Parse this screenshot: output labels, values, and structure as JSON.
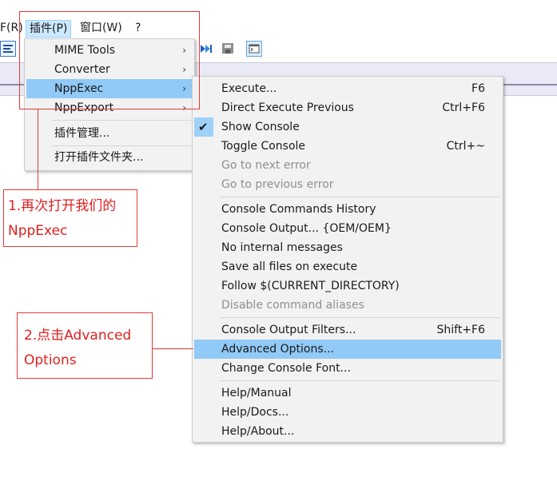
{
  "menubar": {
    "item_r": "F(R)",
    "plugins": "插件(P)",
    "window": "窗口(W)",
    "help": "?"
  },
  "plugins_menu": {
    "items": [
      {
        "label": "MIME Tools",
        "arrow": "›"
      },
      {
        "label": "Converter",
        "arrow": "›"
      },
      {
        "label": "NppExec",
        "arrow": "›"
      },
      {
        "label": "NppExport",
        "arrow": "›"
      },
      {
        "label": "插件管理..."
      },
      {
        "label": "打开插件文件夹..."
      }
    ]
  },
  "nppexec_menu": {
    "items": [
      {
        "label": "Execute...",
        "accel": "F6"
      },
      {
        "label": "Direct Execute Previous",
        "accel": "Ctrl+F6"
      },
      {
        "label": "Show Console",
        "accel": "",
        "checked": true
      },
      {
        "label": "Toggle Console",
        "accel": "Ctrl+~"
      },
      {
        "label": "Go to next error",
        "accel": ""
      },
      {
        "label": "Go to previous error",
        "accel": ""
      },
      {
        "label": "Console Commands History",
        "accel": ""
      },
      {
        "label": "Console Output... {OEM/OEM}",
        "accel": ""
      },
      {
        "label": "No internal messages",
        "accel": ""
      },
      {
        "label": "Save all files on execute",
        "accel": ""
      },
      {
        "label": "Follow $(CURRENT_DIRECTORY)",
        "accel": ""
      },
      {
        "label": "Disable command aliases",
        "accel": ""
      },
      {
        "label": "Console Output Filters...",
        "accel": "Shift+F6"
      },
      {
        "label": "Advanced Options...",
        "accel": ""
      },
      {
        "label": "Change Console Font...",
        "accel": ""
      },
      {
        "label": "Help/Manual",
        "accel": ""
      },
      {
        "label": "Help/Docs...",
        "accel": ""
      },
      {
        "label": "Help/About...",
        "accel": ""
      }
    ],
    "check_glyph": "✔"
  },
  "annotations": {
    "step1_line1": "1.再次打开我们的",
    "step1_line2": "NppExec",
    "step2_line1": "2.点击Advanced",
    "step2_line2": "Options"
  },
  "colors": {
    "highlight": "#91c9f7",
    "annotation": "#e53935",
    "menu_bg": "#f2f2f2"
  }
}
